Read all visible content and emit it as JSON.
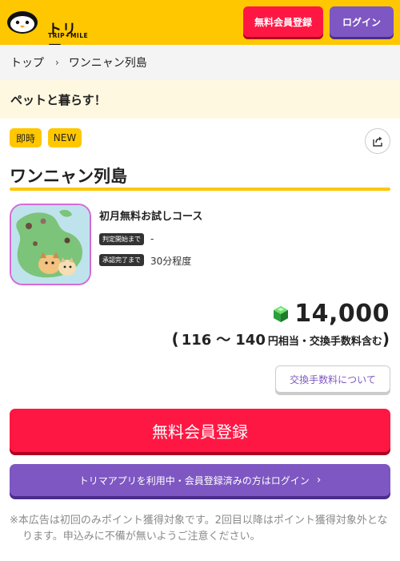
{
  "header": {
    "logo_text": "トリマ",
    "logo_sub": "TRIP✦MILE",
    "register_label": "無料会員登録",
    "login_label": "ログイン"
  },
  "breadcrumb": {
    "home": "トップ",
    "separator": "›",
    "current": "ワンニャン列島"
  },
  "banner": {
    "text": "ペットと暮らす！"
  },
  "tags": [
    "即時",
    "NEW"
  ],
  "offer": {
    "title": "ワンニャン列島",
    "course": "初月無料お試しコース",
    "judge_start_label": "判定開始まで",
    "judge_start_value": "-",
    "approval_label": "承認完了まで",
    "approval_value": "30分程度"
  },
  "reward": {
    "points": "14,000",
    "yen_open": "(",
    "yen_min": "116",
    "yen_sep": "〜",
    "yen_max": "140",
    "yen_suffix": "円相当・交換手数料含む",
    "yen_close": ")"
  },
  "fee_button": "交換手数料について",
  "cta": {
    "register": "無料会員登録",
    "login": "トリマアプリを利用中・会員登録済みの方はログイン"
  },
  "notice": "※本広告は初回のみポイント獲得対象です。2回目以降はポイント獲得対象外となります。申込みに不備が無いようご注意ください。",
  "icons": {
    "logo": "penguin-logo-icon",
    "share": "share-icon",
    "gem": "green-gem-icon",
    "chevron": "chevron-right-icon"
  },
  "colors": {
    "brand_yellow": "#ffc700",
    "register_red": "#ff1744",
    "login_purple": "#7e57c2"
  }
}
